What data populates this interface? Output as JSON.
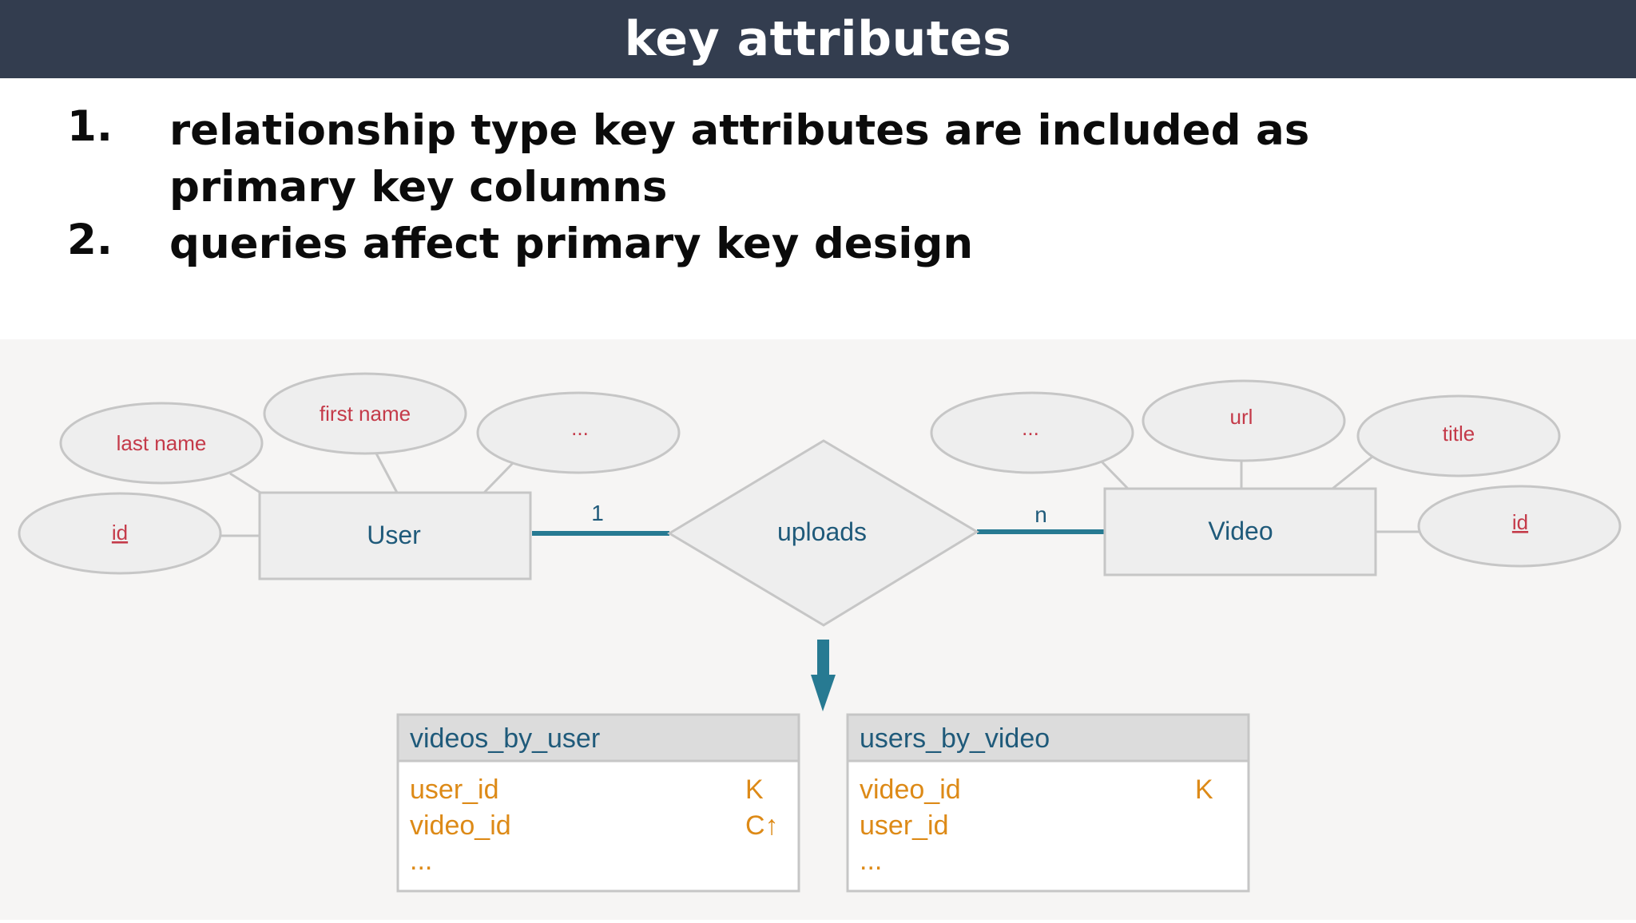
{
  "slide": {
    "title": "key attributes",
    "points": [
      {
        "number": "1.",
        "text": "relationship type key attributes are included as primary key columns"
      },
      {
        "number": "2.",
        "text": "queries affect primary key design"
      }
    ]
  },
  "diagram": {
    "user_entity": {
      "name": "User",
      "attributes": {
        "last_name": "last name",
        "first_name": "first name",
        "more": "...",
        "id": "id"
      }
    },
    "relationship": {
      "name": "uploads",
      "user_cardinality": "1",
      "video_cardinality": "n"
    },
    "video_entity": {
      "name": "Video",
      "attributes": {
        "more": "...",
        "url": "url",
        "title": "title",
        "id": "id"
      }
    },
    "tables": [
      {
        "name": "videos_by_user",
        "rows": [
          {
            "column": "user_id",
            "key": "K"
          },
          {
            "column": "video_id",
            "key": "C↑"
          },
          {
            "column": "...",
            "key": ""
          }
        ]
      },
      {
        "name": "users_by_video",
        "rows": [
          {
            "column": "video_id",
            "key": "K"
          },
          {
            "column": "user_id",
            "key": ""
          },
          {
            "column": "...",
            "key": ""
          }
        ]
      }
    ]
  },
  "colors": {
    "title_bar": "#333d4f",
    "entity_fill": "#eeeeee",
    "outline": "#c6c6c6",
    "attribute_text": "#c43a49",
    "entity_text": "#1f5a7a",
    "relationship_line": "#277a92",
    "table_column_text": "#dd8a17"
  }
}
